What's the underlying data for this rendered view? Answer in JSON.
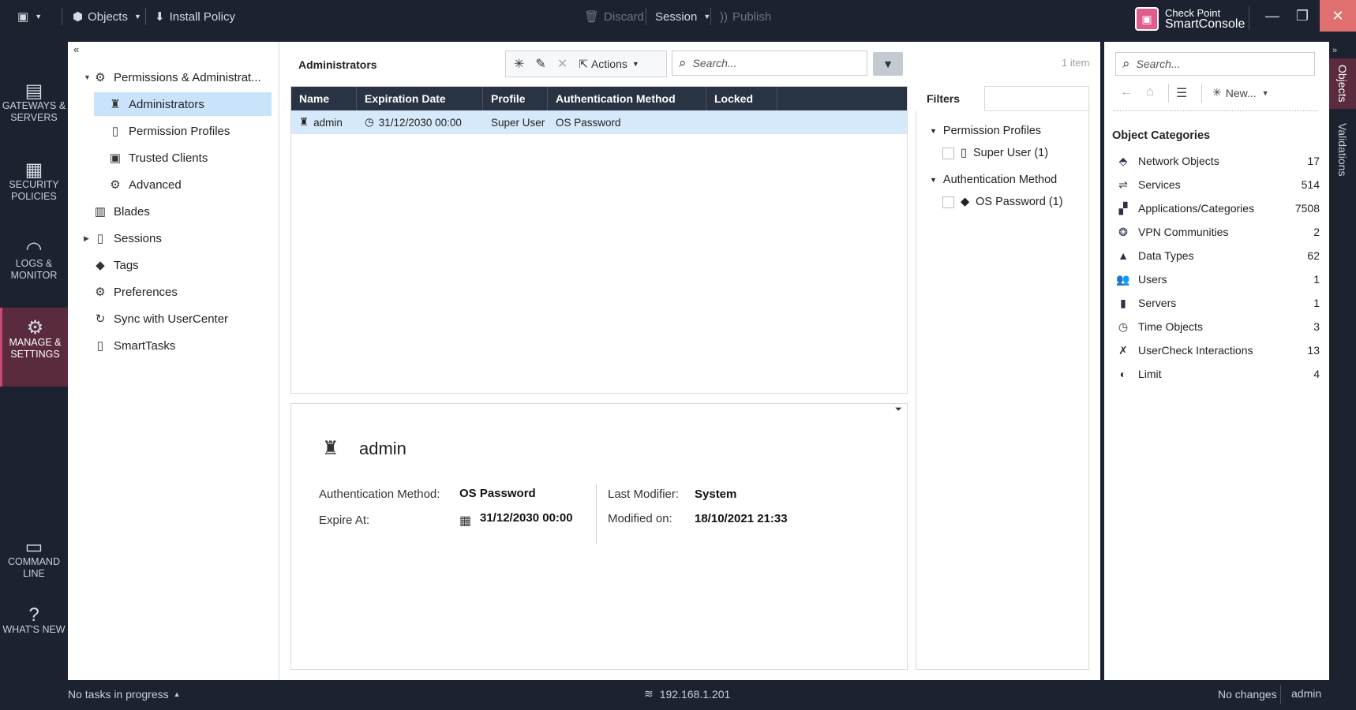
{
  "topbar": {
    "objects_label": "Objects",
    "install_policy_label": "Install Policy",
    "discard_label": "Discard",
    "session_label": "Session",
    "publish_label": "Publish",
    "brand_line1": "Check Point",
    "brand_line2": "SmartConsole"
  },
  "leftnav": {
    "gateways": "GATEWAYS & SERVERS",
    "security": "SECURITY POLICIES",
    "logs": "LOGS & MONITOR",
    "manage": "MANAGE & SETTINGS",
    "command": "COMMAND LINE",
    "whatsnew": "WHAT'S NEW"
  },
  "tree": {
    "items": [
      {
        "label": "Permissions & Administrat..."
      },
      {
        "label": "Administrators"
      },
      {
        "label": "Permission Profiles"
      },
      {
        "label": "Trusted Clients"
      },
      {
        "label": "Advanced"
      },
      {
        "label": "Blades"
      },
      {
        "label": "Sessions"
      },
      {
        "label": "Tags"
      },
      {
        "label": "Preferences"
      },
      {
        "label": "Sync with UserCenter"
      },
      {
        "label": "SmartTasks"
      }
    ]
  },
  "main": {
    "title": "Administrators",
    "actions_label": "Actions",
    "search_placeholder": "Search...",
    "item_count": "1 item",
    "columns": [
      "Name",
      "Expiration Date",
      "Profile",
      "Authentication Method",
      "Locked"
    ],
    "rows": [
      {
        "name": "admin",
        "expiration": "31/12/2030 00:00",
        "profile": "Super User",
        "auth": "OS Password",
        "locked": ""
      }
    ]
  },
  "filters": {
    "tab_label": "Filters",
    "groups": [
      {
        "title": "Permission Profiles",
        "option": "Super User (1)"
      },
      {
        "title": "Authentication Method",
        "option": "OS Password (1)"
      }
    ]
  },
  "details": {
    "name": "admin",
    "auth_label": "Authentication Method:",
    "auth_value": "OS Password",
    "expire_label": "Expire At:",
    "expire_value": "31/12/2030 00:00",
    "modifier_label": "Last Modifier:",
    "modifier_value": "System",
    "modified_label": "Modified on:",
    "modified_value": "18/10/2021 21:33"
  },
  "rightpanel": {
    "search_placeholder": "Search...",
    "new_label": "New...",
    "categories_title": "Object Categories",
    "categories": [
      {
        "name": "Network Objects",
        "count": "17"
      },
      {
        "name": "Services",
        "count": "514"
      },
      {
        "name": "Applications/Categories",
        "count": "7508"
      },
      {
        "name": "VPN Communities",
        "count": "2"
      },
      {
        "name": "Data Types",
        "count": "62"
      },
      {
        "name": "Users",
        "count": "1"
      },
      {
        "name": "Servers",
        "count": "1"
      },
      {
        "name": "Time Objects",
        "count": "3"
      },
      {
        "name": "UserCheck Interactions",
        "count": "13"
      },
      {
        "name": "Limit",
        "count": "4"
      }
    ]
  },
  "vtabs": {
    "objects": "Objects",
    "validations": "Validations"
  },
  "status": {
    "tasks": "No tasks in progress",
    "server": "192.168.1.201",
    "changes": "No changes",
    "user": "admin"
  }
}
